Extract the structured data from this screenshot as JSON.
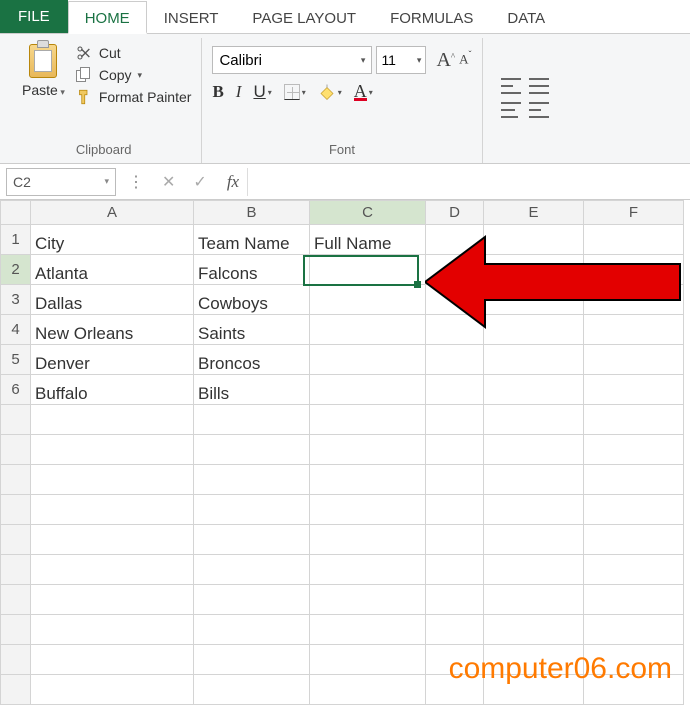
{
  "tabs": {
    "file": "FILE",
    "home": "HOME",
    "insert": "INSERT",
    "pageLayout": "PAGE LAYOUT",
    "formulas": "FORMULAS",
    "data": "DATA"
  },
  "clipboard": {
    "paste": "Paste",
    "cut": "Cut",
    "copy": "Copy",
    "formatPainter": "Format Painter",
    "groupLabel": "Clipboard"
  },
  "font": {
    "name": "Calibri",
    "size": "11",
    "groupLabel": "Font",
    "bold": "B",
    "italic": "I",
    "underline": "U",
    "fontColor": "A"
  },
  "nameBox": "C2",
  "fx": "fx",
  "columns": [
    "A",
    "B",
    "C",
    "D",
    "E",
    "F"
  ],
  "rows": [
    "1",
    "2",
    "3",
    "4",
    "5",
    "6"
  ],
  "cells": {
    "A1": "City",
    "B1": "Team Name",
    "C1": "Full Name",
    "A2": "Atlanta",
    "B2": "Falcons",
    "A3": "Dallas",
    "B3": "Cowboys",
    "A4": "New Orleans",
    "B4": "Saints",
    "A5": "Denver",
    "B5": "Broncos",
    "A6": "Buffalo",
    "B6": "Bills"
  },
  "watermark": "computer06.com",
  "chart_data": {
    "type": "table",
    "title": "",
    "columns": [
      "City",
      "Team Name",
      "Full Name"
    ],
    "rows": [
      [
        "Atlanta",
        "Falcons",
        ""
      ],
      [
        "Dallas",
        "Cowboys",
        ""
      ],
      [
        "New Orleans",
        "Saints",
        ""
      ],
      [
        "Denver",
        "Broncos",
        ""
      ],
      [
        "Buffalo",
        "Bills",
        ""
      ]
    ]
  }
}
